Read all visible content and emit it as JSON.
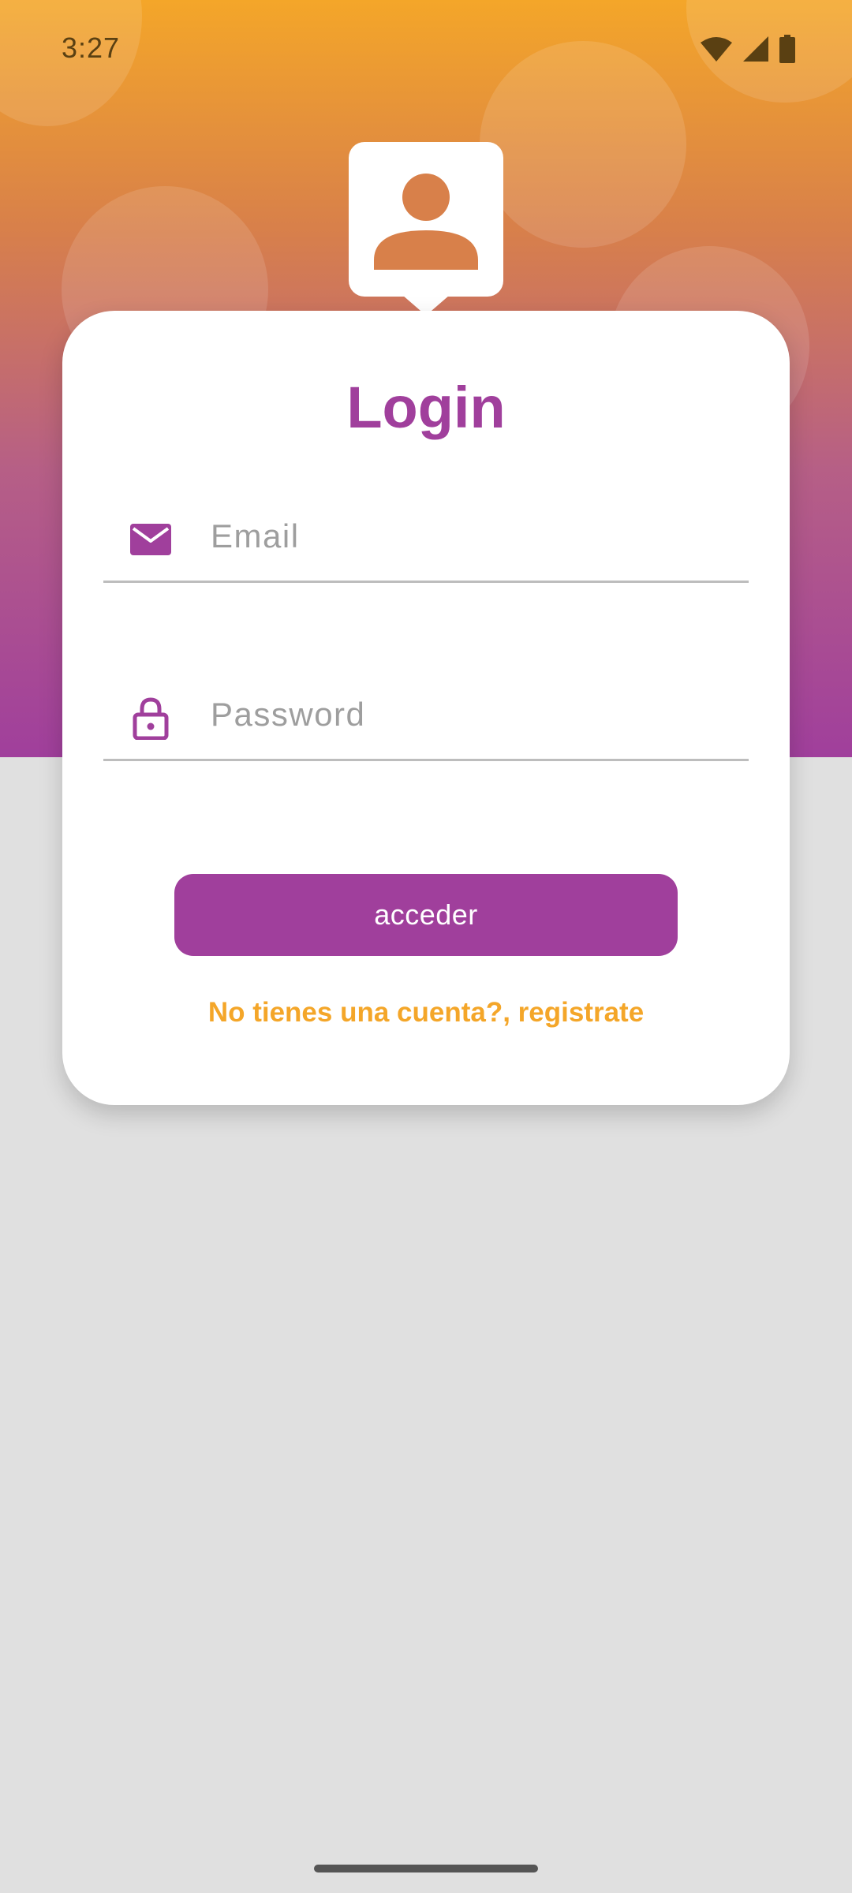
{
  "status_bar": {
    "time": "3:27",
    "icons": [
      "wifi-icon",
      "cell-signal-icon",
      "battery-icon"
    ]
  },
  "login_card": {
    "title": "Login",
    "email": {
      "icon": "mail-icon",
      "placeholder": "Email",
      "value": ""
    },
    "password": {
      "icon": "lock-icon",
      "placeholder": "Password",
      "value": ""
    },
    "submit_label": "acceder",
    "register_link": "No tienes una cuenta?, registrate"
  },
  "avatar_icon": "person-icon",
  "colors": {
    "primary": "#a03f9c",
    "accent": "#f4a629",
    "gradient_top": "#f4a629",
    "gradient_bottom": "#a03f9c",
    "background": "#e0e0e0"
  }
}
